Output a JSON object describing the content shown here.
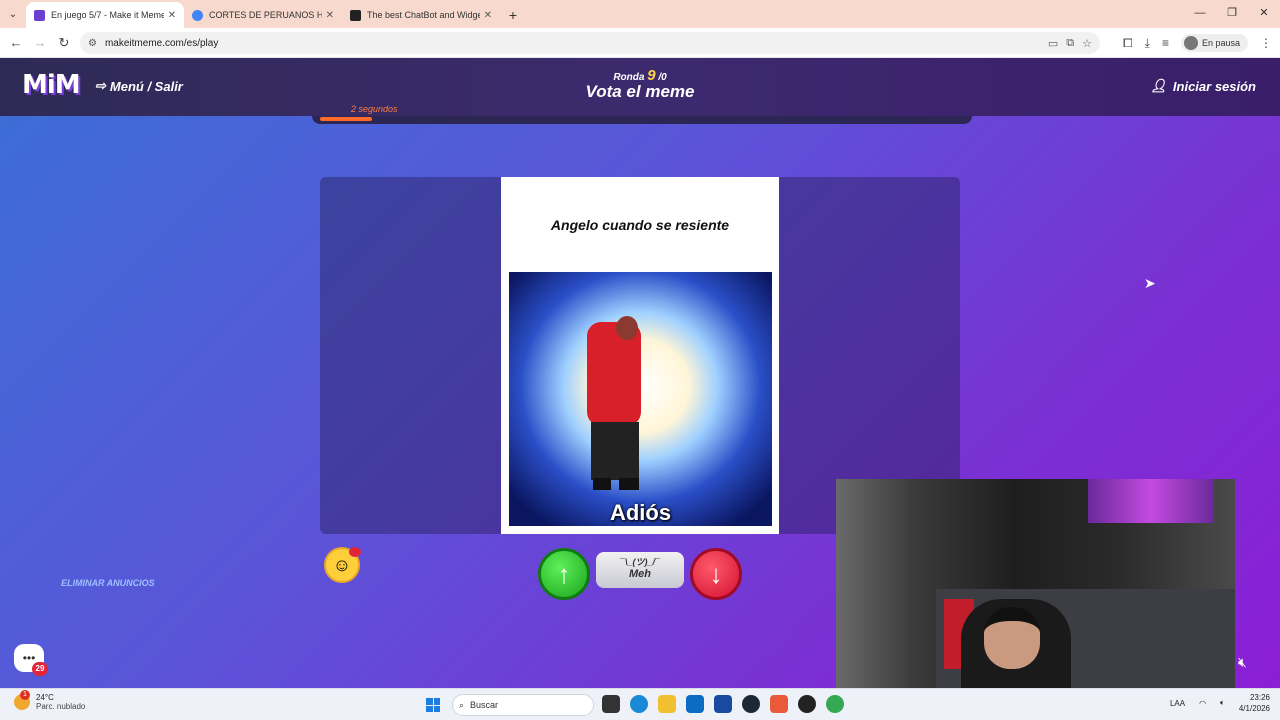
{
  "browser": {
    "tabs": [
      {
        "title": "En juego 5/7 - Make it Meme",
        "active": true
      },
      {
        "title": "CORTES DE PERUANOS HORRIB",
        "active": false
      },
      {
        "title": "The best ChatBot and Widgets",
        "active": false
      }
    ],
    "url": "makeitmeme.com/es/play",
    "profile_label": "En pausa"
  },
  "site": {
    "logo": "MiM",
    "menu_label": "Menú / Salir",
    "round_label": "Ronda",
    "round_number": "9",
    "round_total": "/0",
    "page_title": "Vota el meme",
    "login_label": "Iniciar sesión",
    "timer_label": "2 segundos",
    "timer_progress": 0.08
  },
  "meme": {
    "caption": "Angelo cuando se resiente",
    "image_text": "Adiós"
  },
  "vote": {
    "up_icon": "↑",
    "meh_shrug": "¯\\_(ツ)_/¯",
    "meh_label": "Meh",
    "down_icon": "↓"
  },
  "ads": {
    "remove_label": "ELIMINAR ANUNCIOS"
  },
  "chatbot": {
    "badge_count": "29"
  },
  "taskbar": {
    "weather_temp": "24°C",
    "weather_desc": "Parc. nublado",
    "weather_badge": "1",
    "search_placeholder": "Buscar",
    "lang": "LAA",
    "time": "23:26",
    "date": "4/1/2026"
  },
  "colors": {
    "accent": "#ffd54a",
    "timer": "#ff6a2a",
    "upvote": "#1aa31c",
    "downvote": "#d31033"
  }
}
